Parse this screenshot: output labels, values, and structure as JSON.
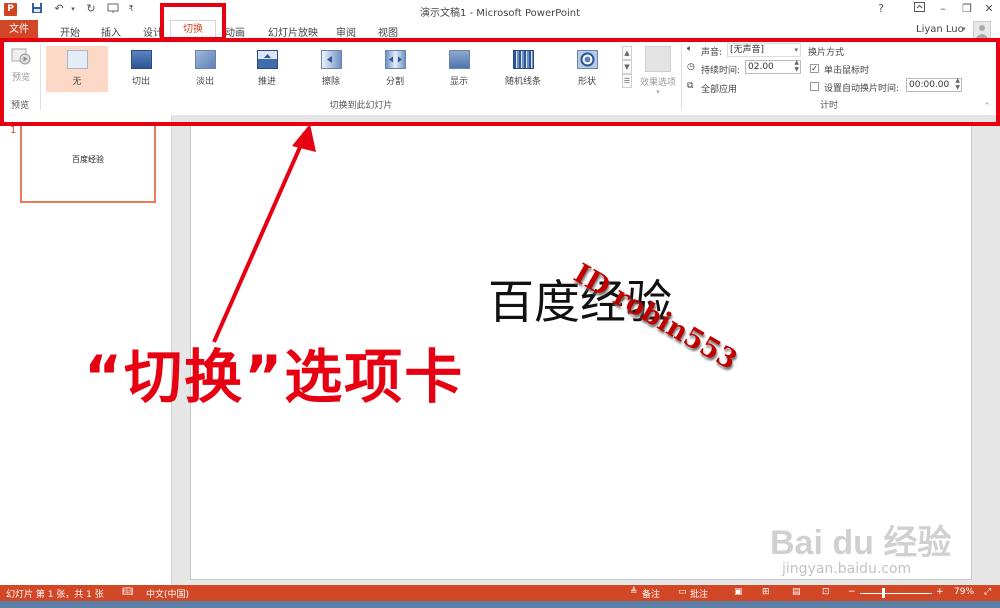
{
  "window": {
    "title": "演示文稿1 - Microsoft PowerPoint",
    "app_icon": "P",
    "help": "?",
    "user": "Liyan Luo"
  },
  "tabs": [
    {
      "label": "文件"
    },
    {
      "label": "开始"
    },
    {
      "label": "插入"
    },
    {
      "label": "设计"
    },
    {
      "label": "切换"
    },
    {
      "label": "动画"
    },
    {
      "label": "幻灯片放映"
    },
    {
      "label": "审阅"
    },
    {
      "label": "视图"
    }
  ],
  "ribbon": {
    "preview": {
      "button_label": "预览",
      "group_label": "预览"
    },
    "transitions": [
      {
        "label": "无"
      },
      {
        "label": "切出"
      },
      {
        "label": "淡出"
      },
      {
        "label": "推进"
      },
      {
        "label": "擦除"
      },
      {
        "label": "分割"
      },
      {
        "label": "显示"
      },
      {
        "label": "随机线条"
      },
      {
        "label": "形状"
      }
    ],
    "effect_options_label": "效果选项",
    "transition_group_label": "切换到此幻灯片",
    "timing": {
      "sound_label": "声音:",
      "sound_value": "[无声音]",
      "duration_label": "持续时间:",
      "duration_value": "02.00",
      "apply_all_label": "全部应用",
      "advance_heading": "换片方式",
      "on_click_label": "单击鼠标时",
      "on_click_checked": "✓",
      "after_label": "设置自动换片时间:",
      "after_value": "00:00.00",
      "group_label": "计时"
    }
  },
  "slides_pane": {
    "number": "1",
    "thumb_text": "百度经验"
  },
  "slide": {
    "title": "百度经验",
    "watermark": "ID robin553"
  },
  "annotation": {
    "text": "“切换”选项卡",
    "color": "#e60012"
  },
  "logo_watermark": {
    "brand": "Bai du 经验",
    "url": "jingyan.baidu.com"
  },
  "statusbar": {
    "slide_info": "幻灯片 第 1 张，共 1 张",
    "language": "中文(中国)",
    "notes": "备注",
    "comments": "批注",
    "zoom": "79%"
  },
  "colors": {
    "accent": "#d24726",
    "annotation_red": "#e60012"
  }
}
